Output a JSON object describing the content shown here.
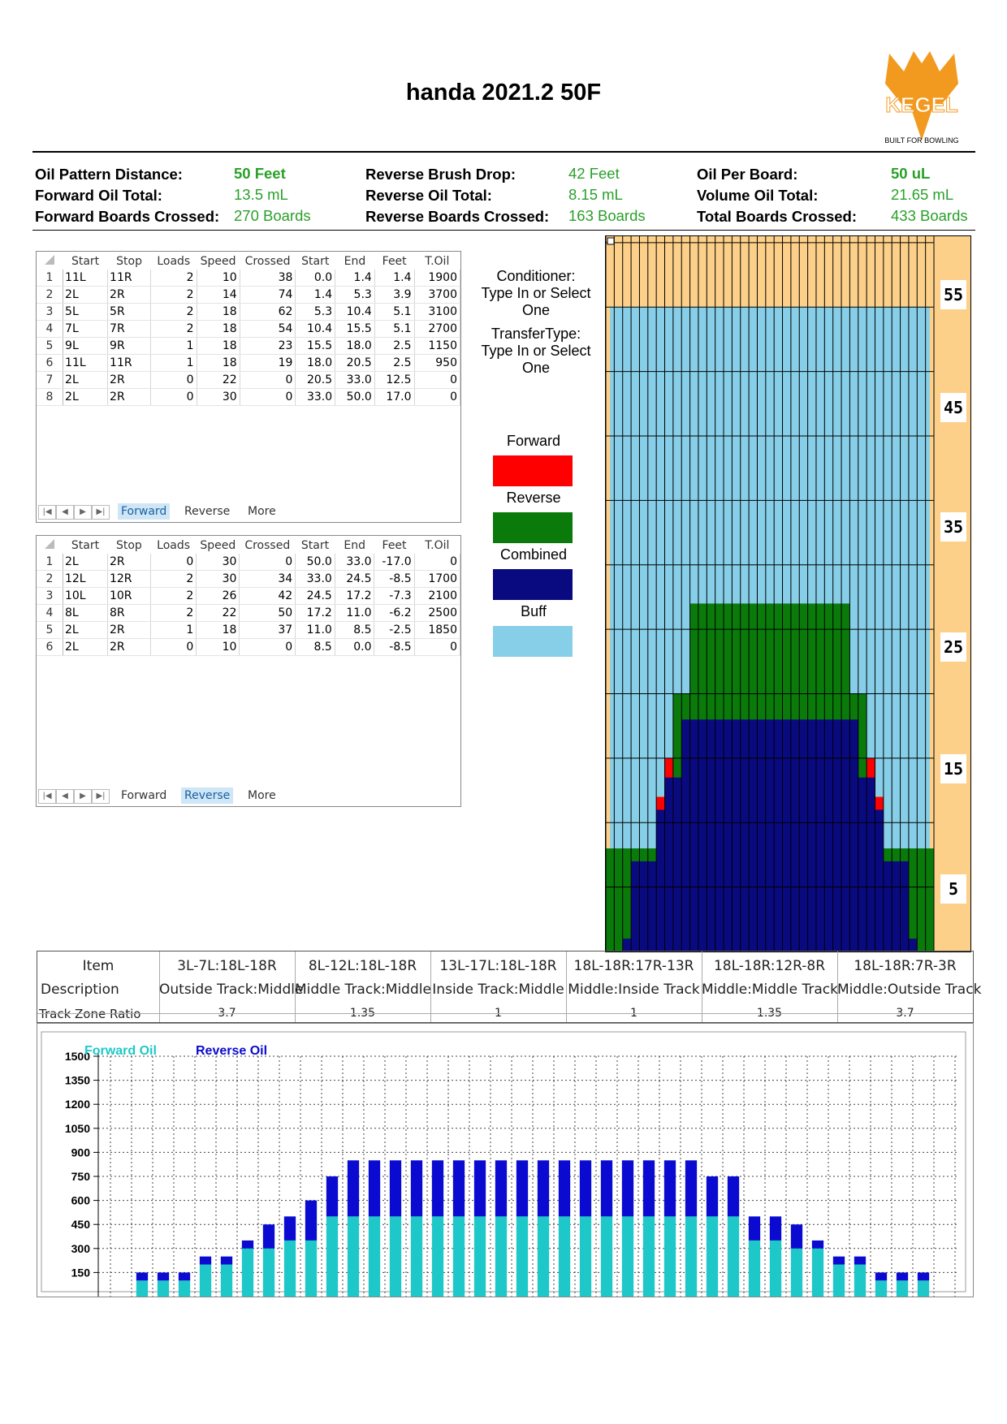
{
  "title": "handa 2021.2 50F",
  "logo": {
    "text": "KEGEL",
    "tagline": "BUILT FOR BOWLING",
    "color": "#f29a1f"
  },
  "summary": {
    "col1": [
      {
        "label": "Oil Pattern Distance:",
        "value": "50 Feet"
      },
      {
        "label": "Forward Oil Total:",
        "value": "13.5 mL"
      },
      {
        "label": "Forward Boards Crossed:",
        "value": "270 Boards"
      }
    ],
    "col2": [
      {
        "label": "Reverse Brush Drop:",
        "value": "42 Feet"
      },
      {
        "label": "Reverse Oil Total:",
        "value": "8.15 mL"
      },
      {
        "label": "Reverse Boards Crossed:",
        "value": "163 Boards"
      }
    ],
    "col3": [
      {
        "label": "Oil Per Board:",
        "value": "50 uL"
      },
      {
        "label": "Volume Oil Total:",
        "value": "21.65 mL"
      },
      {
        "label": "Total Boards Crossed:",
        "value": "433 Boards"
      }
    ]
  },
  "grid_headers": [
    "Start",
    "Stop",
    "Loads",
    "Speed",
    "Crossed",
    "Start",
    "End",
    "Feet",
    "T.Oil"
  ],
  "forward_grid": {
    "rows": [
      [
        "1",
        "11L",
        "11R",
        "2",
        "10",
        "38",
        "0.0",
        "1.4",
        "1.4",
        "1900"
      ],
      [
        "2",
        "2L",
        "2R",
        "2",
        "14",
        "74",
        "1.4",
        "5.3",
        "3.9",
        "3700"
      ],
      [
        "3",
        "5L",
        "5R",
        "2",
        "18",
        "62",
        "5.3",
        "10.4",
        "5.1",
        "3100"
      ],
      [
        "4",
        "7L",
        "7R",
        "2",
        "18",
        "54",
        "10.4",
        "15.5",
        "5.1",
        "2700"
      ],
      [
        "5",
        "9L",
        "9R",
        "1",
        "18",
        "23",
        "15.5",
        "18.0",
        "2.5",
        "1150"
      ],
      [
        "6",
        "11L",
        "11R",
        "1",
        "18",
        "19",
        "18.0",
        "20.5",
        "2.5",
        "950"
      ],
      [
        "7",
        "2L",
        "2R",
        "0",
        "22",
        "0",
        "20.5",
        "33.0",
        "12.5",
        "0"
      ],
      [
        "8",
        "2L",
        "2R",
        "0",
        "30",
        "0",
        "33.0",
        "50.0",
        "17.0",
        "0"
      ]
    ],
    "tabs": [
      "Forward",
      "Reverse",
      "More"
    ],
    "active_tab": "Forward"
  },
  "reverse_grid": {
    "rows": [
      [
        "1",
        "2L",
        "2R",
        "0",
        "30",
        "0",
        "50.0",
        "33.0",
        "-17.0",
        "0"
      ],
      [
        "2",
        "12L",
        "12R",
        "2",
        "30",
        "34",
        "33.0",
        "24.5",
        "-8.5",
        "1700"
      ],
      [
        "3",
        "10L",
        "10R",
        "2",
        "26",
        "42",
        "24.5",
        "17.2",
        "-7.3",
        "2100"
      ],
      [
        "4",
        "8L",
        "8R",
        "2",
        "22",
        "50",
        "17.2",
        "11.0",
        "-6.2",
        "2500"
      ],
      [
        "5",
        "2L",
        "2R",
        "1",
        "18",
        "37",
        "11.0",
        "8.5",
        "-2.5",
        "1850"
      ],
      [
        "6",
        "2L",
        "2R",
        "0",
        "10",
        "0",
        "8.5",
        "0.0",
        "-8.5",
        "0"
      ]
    ],
    "tabs": [
      "Forward",
      "Reverse",
      "More"
    ],
    "active_tab": "Reverse"
  },
  "conditioner": {
    "line1": "Conditioner:",
    "line2": "Type In or Select",
    "line3": "One"
  },
  "transfer": {
    "line1": "TransferType:",
    "line2": "Type In or Select",
    "line3": "One"
  },
  "legend": [
    {
      "label": "Forward",
      "color": "#ff0000"
    },
    {
      "label": "Reverse",
      "color": "#0a7a0a"
    },
    {
      "label": "Combined",
      "color": "#0a0a80"
    },
    {
      "label": "Buff",
      "color": "#87cee8"
    }
  ],
  "lane_colors": {
    "no_oil": "#fdd08a",
    "forward": "#ff0000",
    "reverse": "#0a7a0a",
    "combined": "#0a0a80",
    "buff": "#87cee8"
  },
  "lane_feet_labels": [
    "55",
    "45",
    "35",
    "25",
    "15",
    "5"
  ],
  "zone_table": {
    "item_label": "Item",
    "description_label": "Description",
    "ratio_label": "Track Zone Ratio",
    "zones": [
      {
        "boards": "3L-7L:18L-18R",
        "desc": "Outside Track:Middle",
        "ratio": "3.7"
      },
      {
        "boards": "8L-12L:18L-18R",
        "desc": "Middle Track:Middle",
        "ratio": "1.35"
      },
      {
        "boards": "13L-17L:18L-18R",
        "desc": "Inside Track:Middle",
        "ratio": "1"
      },
      {
        "boards": "18L-18R:17R-13R",
        "desc": "Middle:Inside Track",
        "ratio": "1"
      },
      {
        "boards": "18L-18R:12R-8R",
        "desc": "Middle:Middle Track",
        "ratio": "1.35"
      },
      {
        "boards": "18L-18R:7R-3R",
        "desc": "Middle:Outside Track",
        "ratio": "3.7"
      }
    ]
  },
  "chart_data": {
    "type": "bar",
    "stacked": true,
    "series": [
      {
        "name": "Forward Oil",
        "color": "#1ec8c8",
        "values": [
          0,
          100,
          100,
          100,
          200,
          200,
          300,
          300,
          350,
          350,
          500,
          500,
          500,
          500,
          500,
          500,
          500,
          500,
          500,
          500,
          500,
          500,
          500,
          500,
          500,
          500,
          500,
          500,
          500,
          500,
          350,
          350,
          300,
          300,
          200,
          200,
          100,
          100,
          100,
          0
        ]
      },
      {
        "name": "Reverse Oil",
        "color": "#0a0ad0",
        "values": [
          0,
          50,
          50,
          50,
          50,
          50,
          50,
          150,
          150,
          250,
          250,
          350,
          350,
          350,
          350,
          350,
          350,
          350,
          350,
          350,
          350,
          350,
          350,
          350,
          350,
          350,
          350,
          350,
          250,
          250,
          150,
          150,
          150,
          50,
          50,
          50,
          50,
          50,
          50,
          0
        ]
      }
    ],
    "y_ticks": [
      "1500",
      "1350",
      "1200",
      "1050",
      "900",
      "750",
      "600",
      "450",
      "300",
      "150"
    ],
    "ylim": [
      0,
      1500
    ],
    "grid": true,
    "legend": "top-left"
  }
}
